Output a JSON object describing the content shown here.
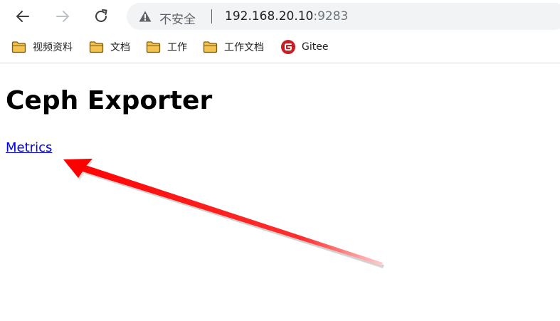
{
  "browser": {
    "security_label": "不安全",
    "url_host": "192.168.20.10",
    "url_port": ":9283",
    "bookmarks": [
      {
        "label": "视频资料",
        "icon": "folder-icon"
      },
      {
        "label": "文档",
        "icon": "folder-icon"
      },
      {
        "label": "工作",
        "icon": "folder-icon"
      },
      {
        "label": "工作文档",
        "icon": "folder-icon"
      },
      {
        "label": "Gitee",
        "icon": "gitee-icon"
      }
    ],
    "icons": {
      "back": "back-arrow-icon",
      "forward": "forward-arrow-icon",
      "reload": "reload-icon",
      "security": "warning-triangle-icon"
    }
  },
  "page": {
    "heading": "Ceph Exporter",
    "link_label": "Metrics"
  },
  "colors": {
    "link": "#0000ee",
    "arrow": "#ff0000",
    "folder": "#f2c14e",
    "gitee": "#c71d23",
    "omnibox": "#f1f3f4"
  }
}
